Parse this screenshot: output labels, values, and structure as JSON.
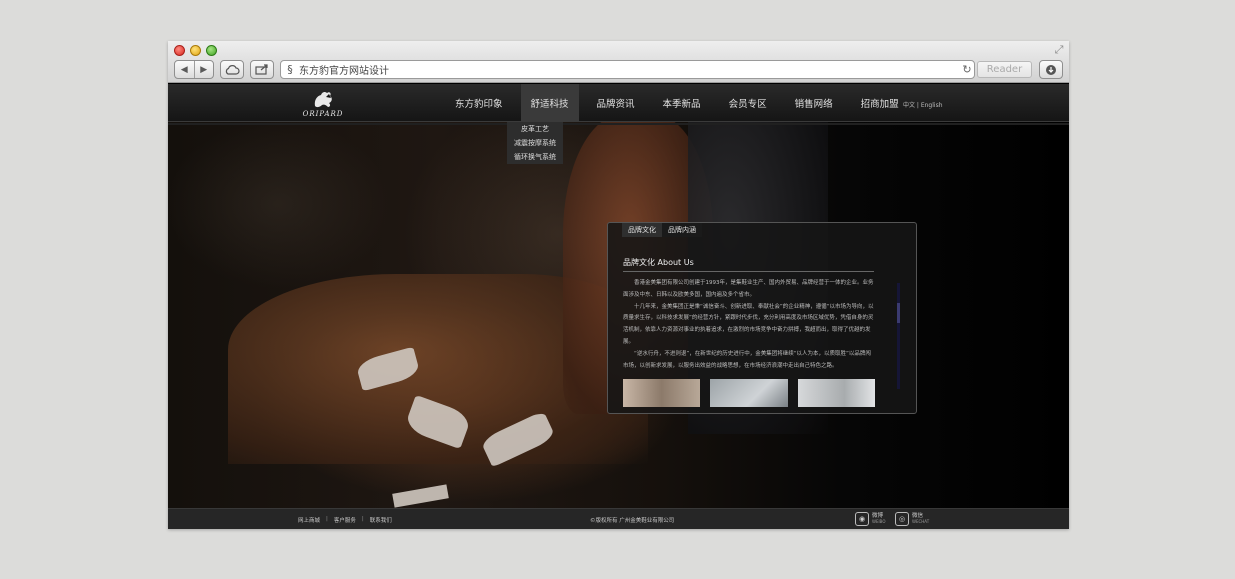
{
  "browser": {
    "nav_back": "◀",
    "nav_forward": "▶",
    "address": "东方豹官方网站设计",
    "reader_label": "Reader"
  },
  "site": {
    "logo_text": "ORIPARD",
    "nav": [
      {
        "label": "东方豹印象"
      },
      {
        "label": "舒适科技"
      },
      {
        "label": "品牌资讯"
      },
      {
        "label": "本季新品"
      },
      {
        "label": "会员专区"
      },
      {
        "label": "销售网络"
      },
      {
        "label": "招商加盟"
      }
    ],
    "lang": "中文 | English",
    "dropdown": [
      "皮革工艺",
      "减震按摩系统",
      "循环换气系统"
    ],
    "panel": {
      "tabs": [
        "品牌文化",
        "品牌内涵"
      ],
      "title": "品牌文化 About Us",
      "paragraphs": [
        "香港金美集团有限公司创建于1993年，是集鞋业生产、国内外贸易、品牌经营于一体的企业。业务面涉及中东、日韩以及欧美多国，国内遍及多个省市。",
        "十几年来，金美集团正是秉“诚信奋斗、创新进取、奉献社会”的企业精神，遵循“以市场为导向，以质量求生存，以科技求发展”的经营方针，紧跟时代步伐，充分利用高度及市场区域优势，凭借自身的灵活机制，依靠人力资源对事业的执着追求，在激烈的市场竞争中奋力拼搏，我超而出，取得了优越的发展。",
        "“逆水行舟，不进则退”，在新世纪的历史进行中，金美集团将继续“以人为本，以质取胜”以品牌闯市场，以创新求发展，以服务出效益的战略思想，在市场经济浪潮中走出自己特色之路。"
      ]
    },
    "footer": {
      "links": [
        "网上商城",
        "客户服务",
        "联系我们"
      ],
      "separator": "|",
      "copyright": "©版权所有  广州金美鞋业有限公司",
      "social": [
        {
          "label": "微博",
          "sub": "WEIBO",
          "icon": "weibo-icon"
        },
        {
          "label": "微信",
          "sub": "WECHAT",
          "icon": "wechat-icon"
        }
      ]
    }
  }
}
